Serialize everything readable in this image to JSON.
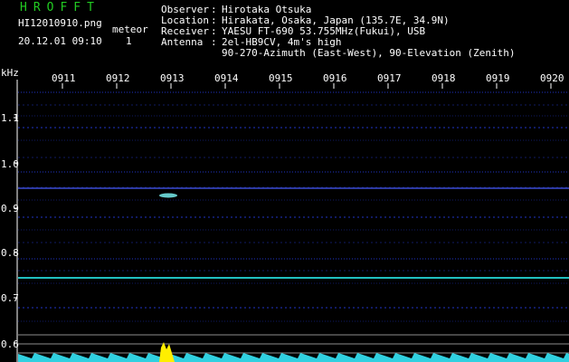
{
  "header": {
    "logo": "HROFFT",
    "filename": "HI12010910.png",
    "meteor_label": "meteor",
    "datetime": "20.12.01 09:10",
    "meteor_count": "1"
  },
  "station": {
    "observer_label": "Observer",
    "observer": "Hirotaka Otsuka",
    "location_label": "Location",
    "location": "Hirakata, Osaka, Japan (135.7E, 34.9N)",
    "receiver_label": "Receiver",
    "receiver": "YAESU FT-690 53.755MHz(Fukui), USB",
    "antenna_label": "Antenna",
    "antenna": "2el-HB9CV, 4m's high",
    "antenna_line2": "90-270-Azimuth (East-West), 90-Elevation (Zenith)",
    "separator": ":"
  },
  "axis": {
    "unit": "kHz",
    "time_ticks": [
      "0911",
      "0912",
      "0913",
      "0914",
      "0915",
      "0916",
      "0917",
      "0918",
      "0919",
      "0920"
    ],
    "freq_ticks": [
      "1.1",
      "1.0",
      "0.9",
      "0.8",
      "0.7",
      "0.6"
    ]
  },
  "colors": {
    "logo": "#22cc22",
    "label": "#ffffff",
    "background": "#000000",
    "noise": "#1a2a9a",
    "carrier": "#20c0c0",
    "meteor": "#ffee00"
  }
}
